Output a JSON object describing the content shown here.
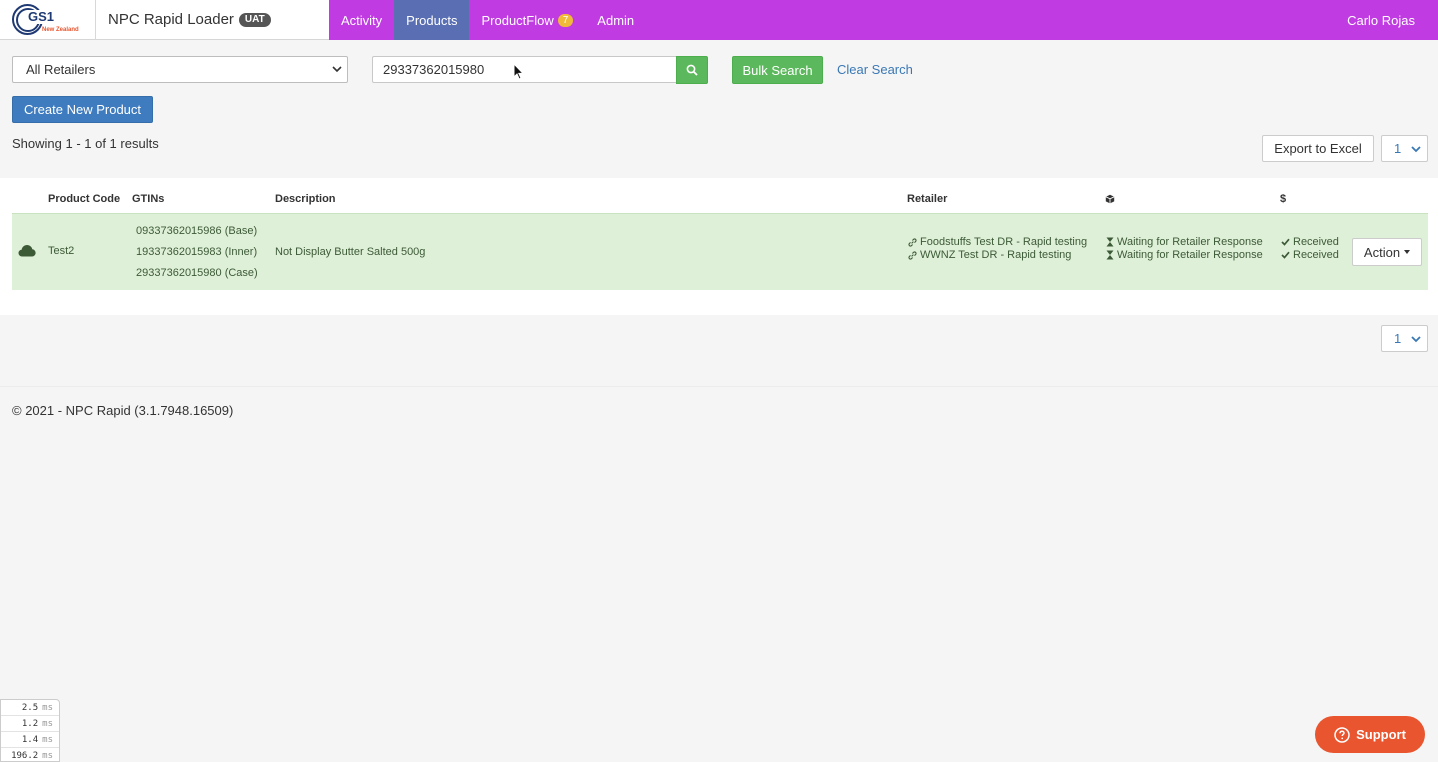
{
  "header": {
    "logo_text": "GS1",
    "logo_subtext": "New Zealand",
    "app_title": "NPC Rapid Loader",
    "env_badge": "UAT",
    "nav": [
      {
        "label": "Activity"
      },
      {
        "label": "Products",
        "active": true
      },
      {
        "label": "ProductFlow",
        "badge": "7"
      },
      {
        "label": "Admin"
      }
    ],
    "user_name": "Carlo Rojas",
    "colors": {
      "nav_bg": "#c03be2",
      "nav_active": "#5a6fb3",
      "badge": "#f0b93a"
    }
  },
  "filters": {
    "retailer_selected": "All Retailers",
    "search_value": "29337362015980",
    "bulk_search_label": "Bulk Search",
    "clear_search_label": "Clear Search"
  },
  "actions": {
    "create_label": "Create New Product",
    "export_label": "Export to Excel"
  },
  "results": {
    "showing_text": "Showing 1 - 1 of 1 results",
    "page_top": "1",
    "page_bottom": "1"
  },
  "table": {
    "columns": {
      "product_code": "Product Code",
      "gtins": "GTINs",
      "description": "Description",
      "retailer": "Retailer",
      "box_icon": "box-icon",
      "price": "$"
    },
    "rows": [
      {
        "product_code": "Test2",
        "gtins": [
          "09337362015986 (Base)",
          "19337362015983 (Inner)",
          "29337362015980 (Case)"
        ],
        "description": "Not Display Butter Salted 500g",
        "retailers": [
          "Foodstuffs Test DR - Rapid testing",
          "WWNZ Test DR - Rapid testing"
        ],
        "statuses": [
          "Waiting for Retailer Response",
          "Waiting for Retailer Response"
        ],
        "price_statuses": [
          "Received",
          "Received"
        ],
        "action_label": "Action",
        "row_color": "#dff0d8"
      }
    ]
  },
  "footer": {
    "text": "© 2021 - NPC Rapid (3.1.7948.16509)"
  },
  "profiler": [
    {
      "value": "2.5",
      "unit": "ms"
    },
    {
      "value": "1.2",
      "unit": "ms"
    },
    {
      "value": "1.4",
      "unit": "ms"
    },
    {
      "value": "196.2",
      "unit": "ms"
    }
  ],
  "support": {
    "label": "Support",
    "color": "#e8552f"
  }
}
